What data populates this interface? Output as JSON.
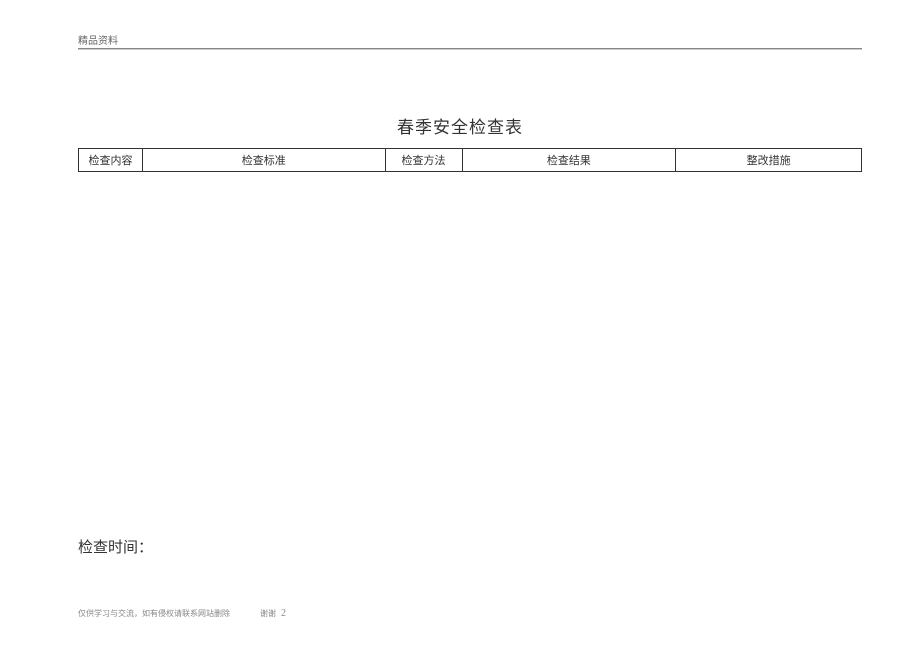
{
  "header": {
    "label": "精品资料"
  },
  "title": "春季安全检查表",
  "table": {
    "headers": [
      "检查内容",
      "检查标准",
      "检查方法",
      "检查结果",
      "整改措施"
    ]
  },
  "checkTime": {
    "label": "检查时间："
  },
  "footer": {
    "disclaimer": "仅供学习与交流，如有侵权请联系网站删除",
    "thanks": "谢谢",
    "pageNumber": "2"
  }
}
